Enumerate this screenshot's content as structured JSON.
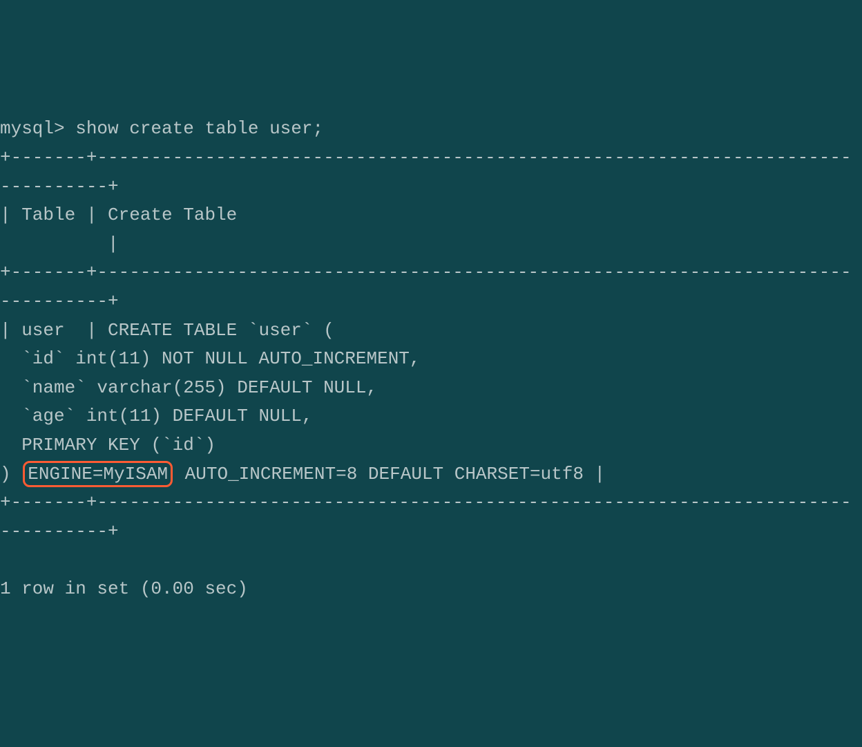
{
  "terminal": {
    "prompt_line": "mysql> show create table user;",
    "border_top": "+-------+----------------------------------------------------------------------",
    "border_top_cont": "----------+",
    "header_row": "| Table | Create Table",
    "header_row_cont": "          |",
    "border_mid": "+-------+----------------------------------------------------------------------",
    "border_mid_cont": "----------+",
    "data_row1": "| user  | CREATE TABLE `user` (",
    "data_row2": "  `id` int(11) NOT NULL AUTO_INCREMENT,",
    "data_row3": "  `name` varchar(255) DEFAULT NULL,",
    "data_row4": "  `age` int(11) DEFAULT NULL,",
    "data_row5": "  PRIMARY KEY (`id`)",
    "data_row6_pre": ") ",
    "engine_clause": "ENGINE=MyISAM",
    "data_row6_post": " AUTO_INCREMENT=8 DEFAULT CHARSET=utf8 |",
    "border_bottom": "+-------+----------------------------------------------------------------------",
    "border_bottom_cont": "----------+",
    "blank": "",
    "result_line": "1 row in set (0.00 sec)"
  }
}
